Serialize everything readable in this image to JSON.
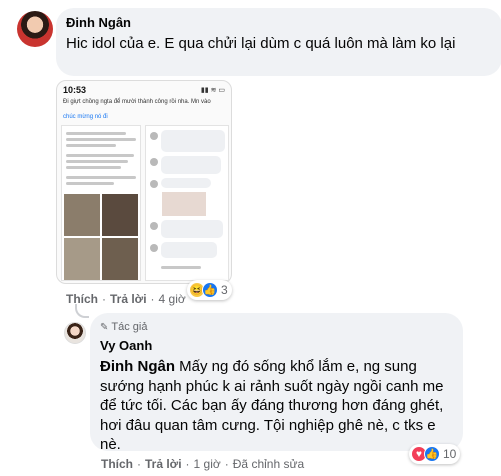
{
  "comment_1": {
    "author": "Đinh Ngân",
    "text": "Hic idol của e. E qua chửi lại dùm c quá luôn mà làm ko lại",
    "actions": {
      "like": "Thích",
      "reply": "Trả lời",
      "time": "4 giờ"
    },
    "reactions": {
      "count": "3",
      "icons": [
        "haha-icon",
        "like-icon"
      ]
    },
    "attachment": {
      "time": "10:53",
      "caption": "Đi giựt chồng ngta để mười thành công rồi nha. Mn vào",
      "caption_link": "chúc mừng nó đi"
    }
  },
  "comment_2": {
    "badge": "Tác giả",
    "author": "Vy Oanh",
    "mention": "Đinh Ngân",
    "text": " Mấy ng đó sống khổ lắm e, ng sung sướng hạnh phúc k ai rảnh suốt ngày ngồi canh me để tức tối. Các bạn ấy đáng thương hơn đáng ghét, hơi đâu quan tâm cưng. Tội nghiệp ghê nè, c tks e nè.",
    "actions": {
      "like": "Thích",
      "reply": "Trả lời",
      "time": "1 giờ",
      "edited": "Đã chỉnh sửa"
    },
    "reactions": {
      "count": "10",
      "icons": [
        "love-icon",
        "like-icon"
      ]
    }
  },
  "colors": {
    "bubble": "#f0f2f5",
    "meta": "#65676b",
    "like_blue": "#1877f2",
    "love_red": "#f33e58",
    "haha_yellow": "#f7c948"
  }
}
